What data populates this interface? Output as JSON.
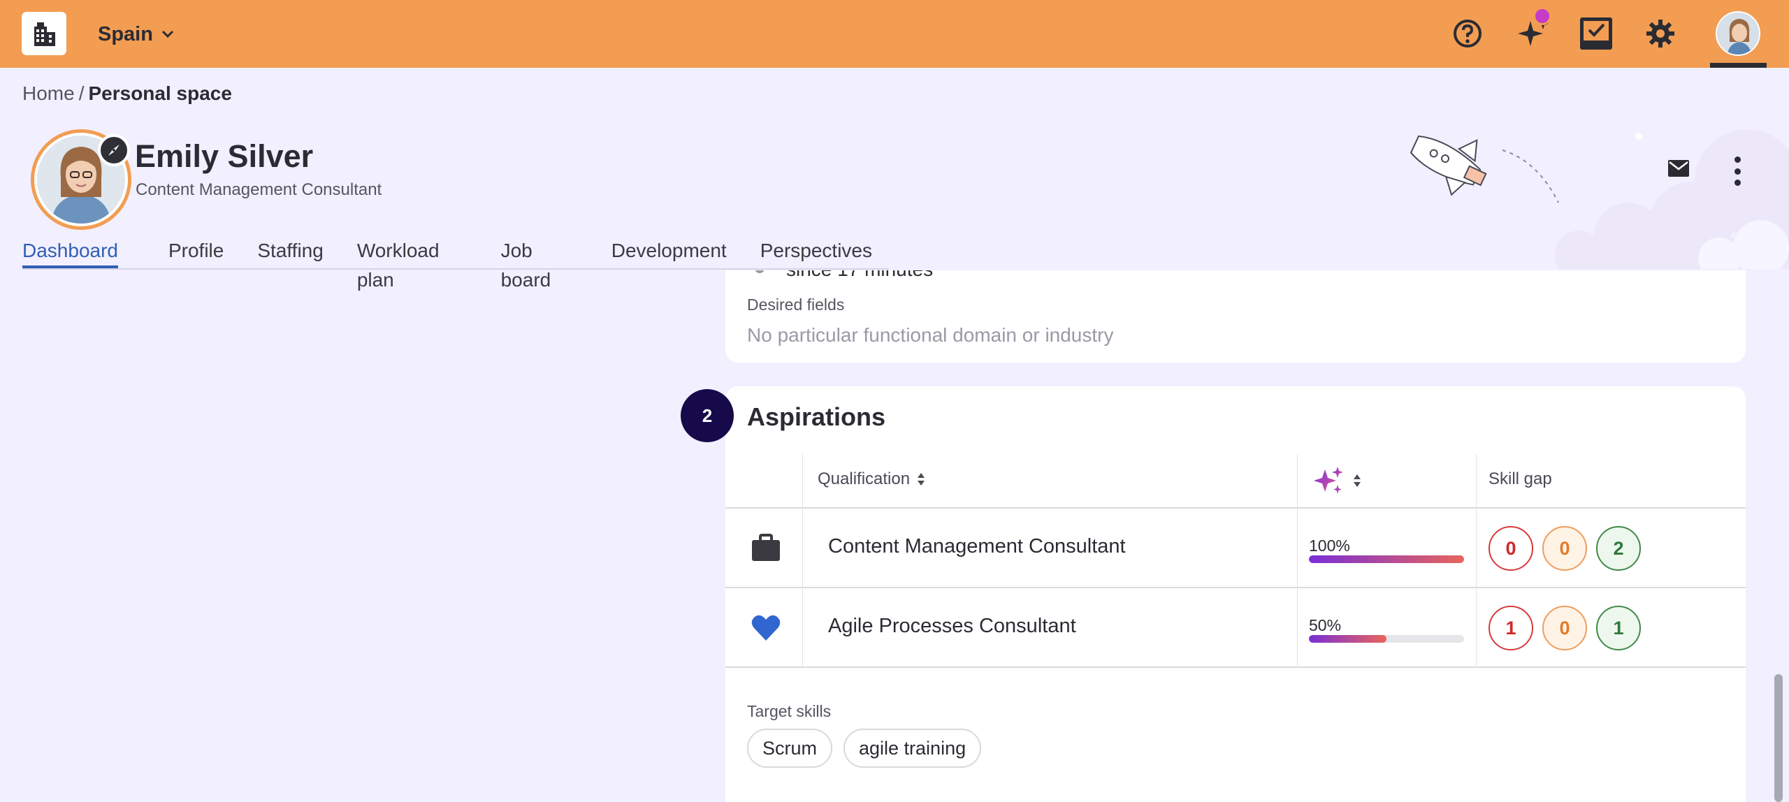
{
  "topbar": {
    "org_name": "Spain",
    "icons": [
      "help-icon",
      "ai-sparkle-icon",
      "tasks-icon",
      "settings-icon"
    ],
    "brand_color": "#f29d52",
    "notification_dot_color": "#c43cc8"
  },
  "breadcrumb": {
    "home": "Home",
    "separator": "/",
    "current": "Personal space"
  },
  "profile": {
    "name": "Emily Silver",
    "role": "Content Management Consultant"
  },
  "tabs": [
    {
      "label": "Dashboard",
      "active": true
    },
    {
      "label": "Profile",
      "active": false
    },
    {
      "label": "Staffing",
      "active": false
    },
    {
      "label": "Workload plan",
      "active": false
    },
    {
      "label": "Job board",
      "active": false
    },
    {
      "label": "Development",
      "active": false
    },
    {
      "label": "Perspectives",
      "active": false
    }
  ],
  "status_card": {
    "since_text": "since 17 minutes",
    "desired_fields_label": "Desired fields",
    "desired_fields_value": "No particular functional domain or industry"
  },
  "aspirations": {
    "step_number": "2",
    "title": "Aspirations",
    "columns": {
      "qualification": "Qualification",
      "match_icon": "ai-sparkle-icon",
      "skill_gap": "Skill gap"
    },
    "rows": [
      {
        "icon": "briefcase-icon",
        "name": "Content Management Consultant",
        "match_label": "100%",
        "match": 1.0,
        "gaps": [
          "0",
          "0",
          "2"
        ]
      },
      {
        "icon": "heart-icon",
        "name": "Agile Processes Consultant",
        "match_label": "50%",
        "match": 0.5,
        "gaps": [
          "1",
          "0",
          "1"
        ]
      }
    ],
    "target_skills_label": "Target skills",
    "target_skills": [
      "Scrum",
      "agile training"
    ]
  }
}
